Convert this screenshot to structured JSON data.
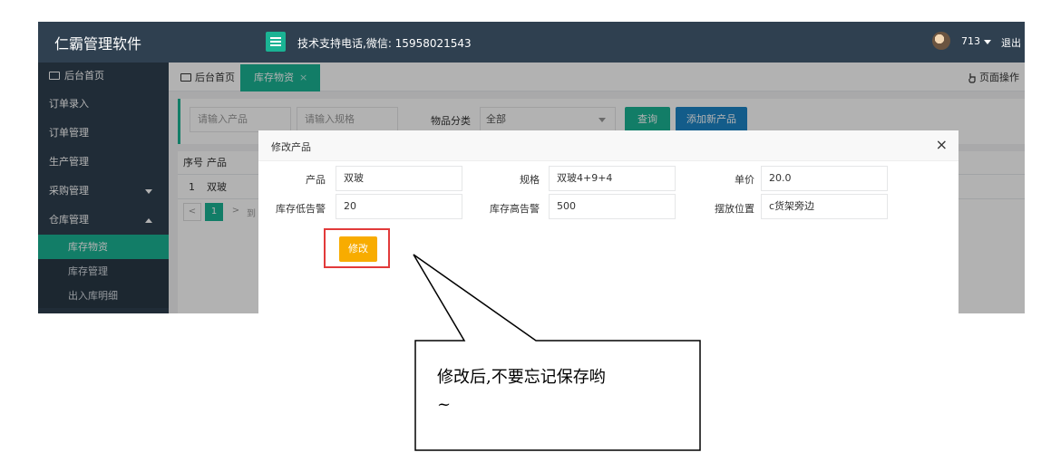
{
  "app": {
    "brand": "仁霸管理软件",
    "support_text": "技术支持电话,微信: 15958021543",
    "username": "713",
    "logout_label": "退出"
  },
  "sidebar": {
    "home_label": "后台首页",
    "items": [
      {
        "label": "订单录入"
      },
      {
        "label": "订单管理"
      },
      {
        "label": "生产管理"
      },
      {
        "label": "采购管理",
        "expanded": false
      },
      {
        "label": "仓库管理",
        "expanded": true
      }
    ],
    "subitems": [
      {
        "label": "库存物资",
        "active": true
      },
      {
        "label": "库存管理"
      },
      {
        "label": "出入库明细"
      }
    ]
  },
  "tabs": {
    "home_label": "后台首页",
    "active_label": "库存物资",
    "close_glyph": "×",
    "page_ops_label": "页面操作"
  },
  "search": {
    "product_placeholder": "请输入产品",
    "spec_placeholder": "请输入规格",
    "category_label": "物品分类",
    "category_value": "全部",
    "query_button": "查询",
    "add_button": "添加新产品"
  },
  "table": {
    "headers": [
      "序号",
      "产品"
    ],
    "rows": [
      {
        "index": "1",
        "product": "双玻"
      }
    ],
    "pager": {
      "current": "1",
      "trail_text": "到"
    }
  },
  "modal": {
    "title": "修改产品",
    "close_glyph": "×",
    "fields": {
      "product": {
        "label": "产品",
        "value": "双玻"
      },
      "spec": {
        "label": "规格",
        "value": "双玻4+9+4"
      },
      "price": {
        "label": "单价",
        "value": "20.0"
      },
      "low_alert": {
        "label": "库存低告警",
        "value": "20"
      },
      "high_alert": {
        "label": "库存高告警",
        "value": "500"
      },
      "location": {
        "label": "摆放位置",
        "value": "c货架旁边"
      }
    },
    "save_button": "修改"
  },
  "callout": {
    "text_line1": "修改后,不要忘记保存哟",
    "text_line2": "~"
  },
  "colors": {
    "sidebar_bg": "#2f4050",
    "accent_green": "#1ab394",
    "accent_blue": "#1c84c6",
    "save_orange": "#f8ac00",
    "highlight_red": "#e23a3a"
  },
  "icons": [
    "monitor-icon",
    "menu-icon",
    "caret-down-icon",
    "caret-up-icon",
    "hand-pointer-icon",
    "close-icon",
    "avatar"
  ]
}
